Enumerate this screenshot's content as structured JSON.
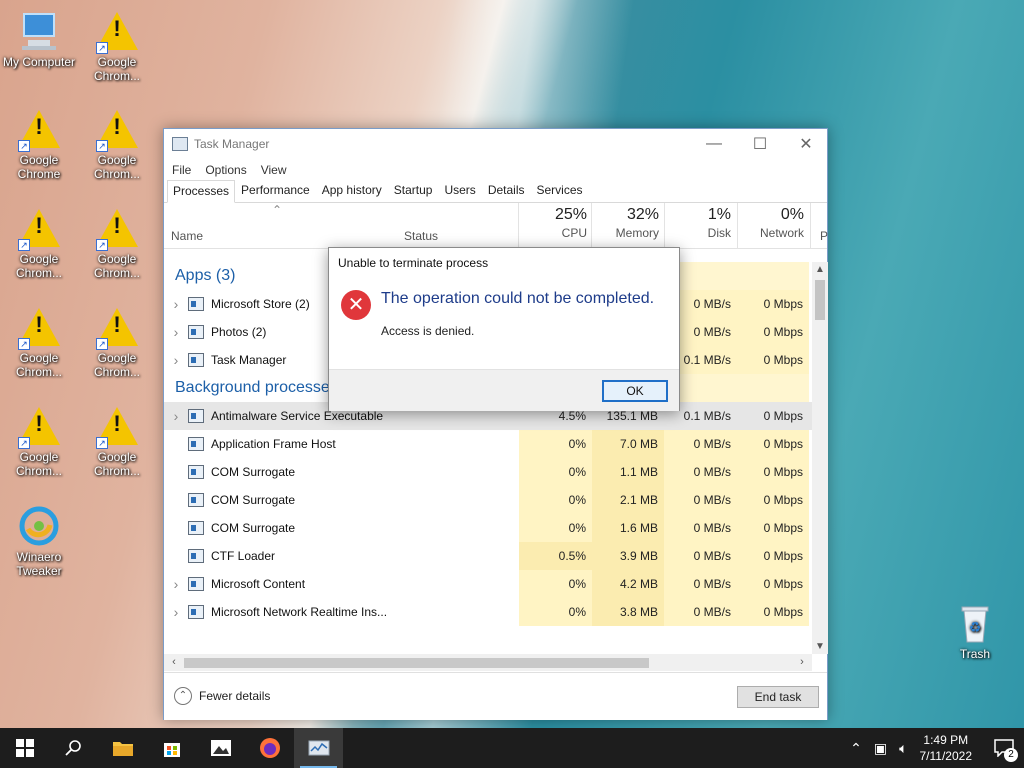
{
  "desktop": {
    "icons_col1": [
      {
        "label": "My Computer",
        "icon": "computer-icon"
      },
      {
        "label": "Google Chrome",
        "icon": "warning-icon"
      },
      {
        "label": "Google Chrom...",
        "icon": "warning-icon"
      },
      {
        "label": "Google Chrom...",
        "icon": "warning-icon"
      },
      {
        "label": "Google Chrom...",
        "icon": "warning-icon"
      },
      {
        "label": "Winaero Tweaker",
        "icon": "winaero-icon"
      }
    ],
    "icons_col2": [
      {
        "label": "Google Chrom...",
        "icon": "warning-icon"
      },
      {
        "label": "Google Chrom...",
        "icon": "warning-icon"
      },
      {
        "label": "Google Chrom...",
        "icon": "warning-icon"
      },
      {
        "label": "Google Chrom...",
        "icon": "warning-icon"
      },
      {
        "label": "Google Chrom...",
        "icon": "warning-icon"
      }
    ],
    "trash": {
      "label": "Trash",
      "icon": "recycle-bin-icon"
    }
  },
  "task_manager": {
    "title": "Task Manager",
    "menu": [
      "File",
      "Options",
      "View"
    ],
    "tabs": [
      "Processes",
      "Performance",
      "App history",
      "Startup",
      "Users",
      "Details",
      "Services"
    ],
    "active_tab": "Processes",
    "columns": {
      "name": "Name",
      "status": "Status",
      "cpu": {
        "pct": "25%",
        "label": "CPU"
      },
      "memory": {
        "pct": "32%",
        "label": "Memory"
      },
      "disk": {
        "pct": "1%",
        "label": "Disk"
      },
      "network": {
        "pct": "0%",
        "label": "Network"
      },
      "power": "P"
    },
    "sections": {
      "apps": "Apps (3)",
      "background": "Background processes (63)"
    },
    "apps": [
      {
        "name": "Microsoft Store (2)",
        "cpu": "",
        "memory": "",
        "disk": "0 MB/s",
        "network": "0 Mbps"
      },
      {
        "name": "Photos (2)",
        "cpu": "",
        "memory": "",
        "disk": "0 MB/s",
        "network": "0 Mbps"
      },
      {
        "name": "Task Manager",
        "cpu": "",
        "memory": "",
        "disk": "0.1 MB/s",
        "network": "0 Mbps"
      }
    ],
    "background": [
      {
        "name": "Antimalware Service Executable",
        "cpu": "4.5%",
        "memory": "135.1 MB",
        "disk": "0.1 MB/s",
        "network": "0 Mbps",
        "expandable": true
      },
      {
        "name": "Application Frame Host",
        "cpu": "0%",
        "memory": "7.0 MB",
        "disk": "0 MB/s",
        "network": "0 Mbps",
        "expandable": false
      },
      {
        "name": "COM Surrogate",
        "cpu": "0%",
        "memory": "1.1 MB",
        "disk": "0 MB/s",
        "network": "0 Mbps",
        "expandable": false
      },
      {
        "name": "COM Surrogate",
        "cpu": "0%",
        "memory": "2.1 MB",
        "disk": "0 MB/s",
        "network": "0 Mbps",
        "expandable": false
      },
      {
        "name": "COM Surrogate",
        "cpu": "0%",
        "memory": "1.6 MB",
        "disk": "0 MB/s",
        "network": "0 Mbps",
        "expandable": false
      },
      {
        "name": "CTF Loader",
        "cpu": "0.5%",
        "memory": "3.9 MB",
        "disk": "0 MB/s",
        "network": "0 Mbps",
        "expandable": false
      },
      {
        "name": "Microsoft Content",
        "cpu": "0%",
        "memory": "4.2 MB",
        "disk": "0 MB/s",
        "network": "0 Mbps",
        "expandable": true
      },
      {
        "name": "Microsoft Network Realtime Ins...",
        "cpu": "0%",
        "memory": "3.8 MB",
        "disk": "0 MB/s",
        "network": "0 Mbps",
        "expandable": true
      }
    ],
    "footer": {
      "fewer_details": "Fewer details",
      "end_task": "End task"
    }
  },
  "dialog": {
    "title": "Unable to terminate process",
    "main": "The operation could not be completed.",
    "sub": "Access is denied.",
    "ok": "OK"
  },
  "taskbar": {
    "time": "1:49 PM",
    "date": "7/11/2022",
    "notification_count": "2"
  }
}
